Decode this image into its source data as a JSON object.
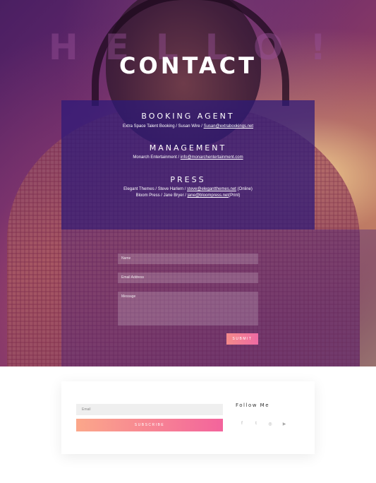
{
  "hero": {
    "watermark": "HELLO!",
    "title": "CONTACT"
  },
  "sections": [
    {
      "heading": "BOOKING AGENT",
      "lines": [
        {
          "text": "Extra Space Talent Booking / Susan Wire / ",
          "link": "Susan@extrabookings.net",
          "suffix": ""
        }
      ]
    },
    {
      "heading": "MANAGEMENT",
      "lines": [
        {
          "text": "Monarch Entertainment / ",
          "link": "info@monarchentertainment.com",
          "suffix": ""
        }
      ]
    },
    {
      "heading": "PRESS",
      "lines": [
        {
          "text": "Elegant Themes / Steve Harlem / ",
          "link": "steve@elegantthemes.net",
          "suffix": " (Online)"
        },
        {
          "text": "Bloom Press / Jane Bryer / ",
          "link": "jane@bloompress.net",
          "suffix": "(Print)"
        }
      ]
    }
  ],
  "form": {
    "name_placeholder": "Name",
    "email_placeholder": "Email Address",
    "message_placeholder": "Message",
    "submit_label": "SUBMIT"
  },
  "newsletter": {
    "email_placeholder": "Email",
    "subscribe_label": "SUBSCRIBE"
  },
  "follow": {
    "title": "Follow Me",
    "icons": [
      "facebook-icon",
      "twitter-icon",
      "instagram-icon",
      "youtube-icon"
    ],
    "glyphs": [
      "f",
      "t",
      "◎",
      "▶"
    ]
  },
  "colors": {
    "accent_start": "#fba78a",
    "accent_end": "#f3649c",
    "panel": "#2c1978"
  }
}
